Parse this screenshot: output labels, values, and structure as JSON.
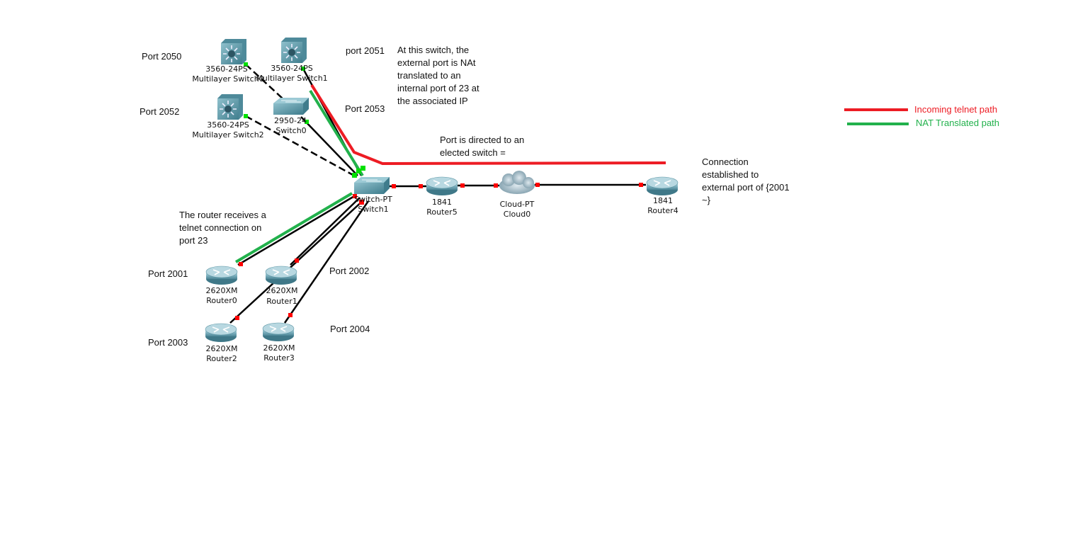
{
  "colors": {
    "incoming": "#ed1c24",
    "nat": "#22b14c",
    "link": "#000000",
    "port_up": "#00e000",
    "port_down": "#ff0000"
  },
  "legend": [
    {
      "label": "Incoming telnet path",
      "color": "#ed1c24"
    },
    {
      "label": "NAT Translated path",
      "color": "#22b14c"
    }
  ],
  "devices": {
    "mls0": {
      "model": "3560-24PS",
      "name": "Multilayer Switch0",
      "icon": "multilayer-switch-icon"
    },
    "mls1": {
      "model": "3560-24PS",
      "name": "Multilayer Switch1",
      "icon": "multilayer-switch-icon"
    },
    "mls2": {
      "model": "3560-24PS",
      "name": "Multilayer Switch2",
      "icon": "multilayer-switch-icon"
    },
    "switch0": {
      "model": "2950-24",
      "name": "Switch0",
      "icon": "switch-icon"
    },
    "switch1": {
      "model": "Switch-PT",
      "name": "Switch1",
      "icon": "switch-icon"
    },
    "router5": {
      "model": "1841",
      "name": "Router5",
      "icon": "router-icon"
    },
    "cloud0": {
      "model": "Cloud-PT",
      "name": "Cloud0",
      "icon": "cloud-icon"
    },
    "router4": {
      "model": "1841",
      "name": "Router4",
      "icon": "router-icon"
    },
    "router0": {
      "model": "2620XM",
      "name": "Router0",
      "icon": "router-icon"
    },
    "router1": {
      "model": "2620XM",
      "name": "Router1",
      "icon": "router-icon"
    },
    "router2": {
      "model": "2620XM",
      "name": "Router2",
      "icon": "router-icon"
    },
    "router3": {
      "model": "2620XM",
      "name": "Router3",
      "icon": "router-icon"
    }
  },
  "ports": {
    "p2050": "Port 2050",
    "p2051": "port 2051",
    "p2052": "Port 2052",
    "p2053": "Port 2053",
    "p2001": "Port 2001",
    "p2002": "Port 2002",
    "p2003": "Port 2003",
    "p2004": "Port 2004"
  },
  "notes": {
    "nat_switch": [
      "At this switch, the",
      "external port is NAt",
      "translated to an",
      "internal port of 23 at",
      "the associated IP"
    ],
    "directed": [
      "Port is directed to an",
      "elected switch ="
    ],
    "established": [
      "Connection",
      "established to",
      "external port of {2001",
      "~}"
    ],
    "router_receives": [
      "The router receives a",
      "telnet connection on",
      "port 23"
    ]
  }
}
